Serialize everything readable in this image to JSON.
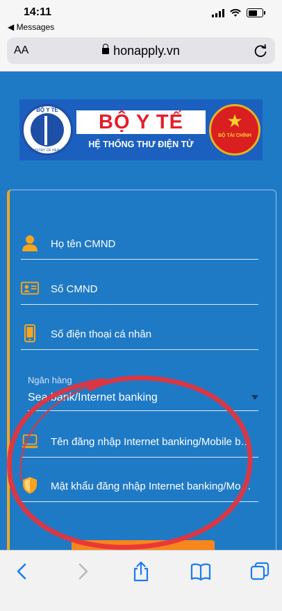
{
  "status_bar": {
    "time": "14:11",
    "back_label": "Messages"
  },
  "address_bar": {
    "text_size_label": "AA",
    "url": "honapply.vn"
  },
  "banner": {
    "title": "BỘ Y TẾ",
    "subtitle": "HỆ THỐNG THƯ ĐIỆN TỬ",
    "left_seal_top": "BỘ Y TẾ",
    "left_seal_bottom": "MINISTRY OF HEALTH",
    "right_seal_text": "BỘ TÀI CHÍNH"
  },
  "form": {
    "full_name_placeholder": "Họ tên CMND",
    "id_number_placeholder": "Số CMND",
    "phone_placeholder": "Số điện thoại cá nhân",
    "bank_label": "Ngân hàng",
    "bank_value": "Sea bank/Internet banking",
    "username_placeholder": "Tên đăng nhập Internet banking/Mobile banking",
    "password_placeholder": "Mật khẩu đăng nhập Internet banking/Mobile banking"
  },
  "colors": {
    "page_background": "#1f7ac6",
    "accent_orange": "#f7a51c",
    "annotation_red": "#e8323a",
    "banner_title_red": "#e41e2b"
  },
  "icons": {
    "toolbar": [
      "back-chevron-icon",
      "forward-chevron-icon",
      "share-icon",
      "bookmarks-icon",
      "tabs-icon"
    ]
  }
}
